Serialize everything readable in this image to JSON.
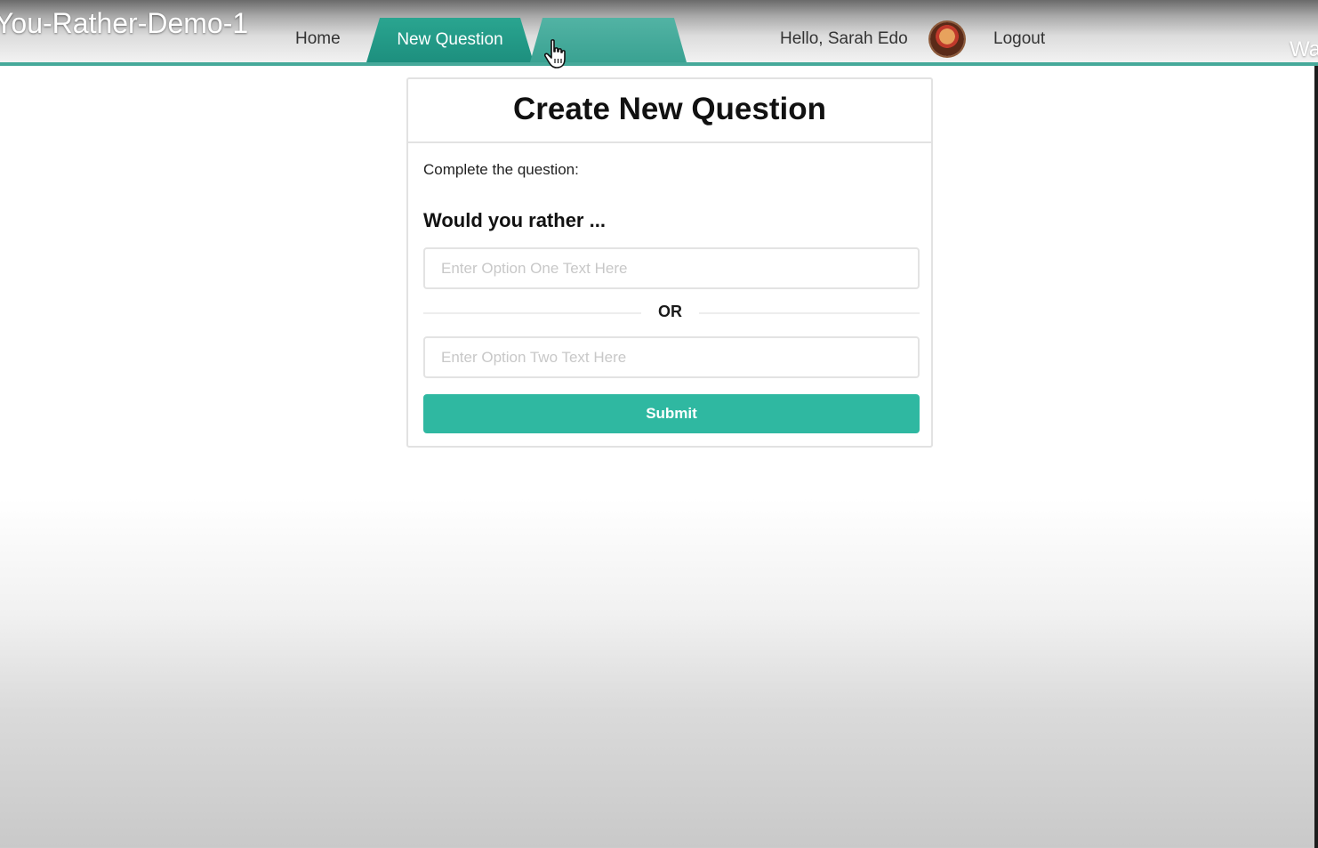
{
  "video": {
    "title": "You-Rather-Demo-1",
    "right_title": "Wa"
  },
  "nav": {
    "home": "Home",
    "new_question": "New Question",
    "leaderboard": "",
    "greeting": "Hello, Sarah Edo",
    "logout": "Logout",
    "avatar_icon": "user-avatar-icon",
    "cursor_icon": "hand-pointer-icon"
  },
  "form": {
    "title": "Create New Question",
    "instruction": "Complete the question:",
    "heading": "Would you rather ...",
    "option_one_value": "",
    "option_one_placeholder": "Enter Option One Text Here",
    "separator": "OR",
    "option_two_value": "",
    "option_two_placeholder": "Enter Option Two Text Here",
    "submit": "Submit"
  },
  "colors": {
    "accent": "#2fb8a1",
    "tab_active": "#1d8f7e",
    "nav_line": "#46a99a"
  }
}
